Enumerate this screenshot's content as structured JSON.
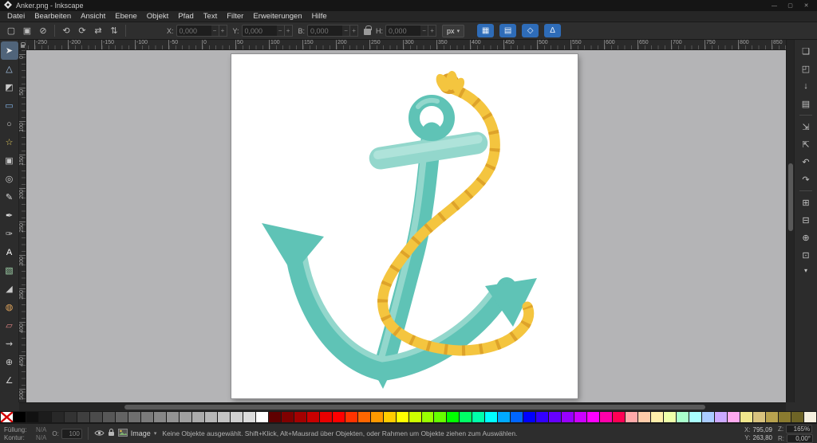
{
  "window": {
    "title": "Anker.png - Inkscape",
    "controls": [
      {
        "name": "minimize-button",
        "glyph": "—"
      },
      {
        "name": "maximize-button",
        "glyph": "▢"
      },
      {
        "name": "close-button",
        "glyph": "✕"
      }
    ]
  },
  "menu": {
    "items": [
      "Datei",
      "Bearbeiten",
      "Ansicht",
      "Ebene",
      "Objekt",
      "Pfad",
      "Text",
      "Filter",
      "Erweiterungen",
      "Hilfe"
    ]
  },
  "toolbar": {
    "select_icons": [
      {
        "name": "select-all-button",
        "glyph": "▢"
      },
      {
        "name": "select-all-layers-button",
        "glyph": "▣"
      },
      {
        "name": "deselect-button",
        "glyph": "⊘"
      }
    ],
    "transform_icons": [
      {
        "name": "rotate-ccw-button",
        "glyph": "⟲"
      },
      {
        "name": "rotate-cw-button",
        "glyph": "⟳"
      },
      {
        "name": "flip-horizontal-button",
        "glyph": "⇄"
      },
      {
        "name": "flip-vertical-button",
        "glyph": "⇅"
      }
    ],
    "fields": [
      {
        "name": "x-field",
        "label": "X:",
        "value": "0,000"
      },
      {
        "name": "y-field",
        "label": "Y:",
        "value": "0,000"
      },
      {
        "name": "width-field",
        "label": "B:",
        "value": "0,000"
      },
      {
        "name": "height-field",
        "label": "H:",
        "value": "0,000"
      }
    ],
    "spin_minus": "−",
    "spin_plus": "+",
    "unit": "px",
    "snap_buttons": [
      {
        "name": "snap-toggle-bounding-box",
        "glyph": "▦"
      },
      {
        "name": "snap-toggle-nodes",
        "glyph": "▤"
      },
      {
        "name": "snap-toggle-others",
        "glyph": "◇"
      },
      {
        "name": "snap-toggle-page",
        "glyph": "∆"
      }
    ]
  },
  "glyphs": {
    "caret_down": "▾"
  },
  "rulers": {
    "h_labels": [
      "-250",
      "-200",
      "-150",
      "-100",
      "-50",
      "0",
      "50",
      "100",
      "150",
      "200",
      "250",
      "300",
      "350",
      "400",
      "450",
      "500",
      "550",
      "600",
      "650",
      "700",
      "750",
      "800",
      "850"
    ],
    "v_labels": [
      "0",
      "50",
      "100",
      "150",
      "200",
      "250",
      "300",
      "350",
      "400",
      "450",
      "500"
    ]
  },
  "toolbox": {
    "tools": [
      {
        "name": "selector-tool",
        "glyph": "➤",
        "color": "#ececec",
        "active": true
      },
      {
        "name": "node-tool",
        "glyph": "△",
        "color": "#a8c8ec"
      },
      {
        "name": "shape-builder-tool",
        "glyph": "◩",
        "color": "#c9c9c9"
      },
      {
        "name": "rectangle-tool",
        "glyph": "▭",
        "color": "#83b3e8"
      },
      {
        "name": "ellipse-tool",
        "glyph": "○",
        "color": "#c9c9c9"
      },
      {
        "name": "star-tool",
        "glyph": "☆",
        "color": "#e8cf5e"
      },
      {
        "name": "box3d-tool",
        "glyph": "▣",
        "color": "#c9c9c9"
      },
      {
        "name": "spiral-tool",
        "glyph": "◎",
        "color": "#c9c9c9"
      },
      {
        "name": "pencil-tool",
        "glyph": "✎",
        "color": "#dcdcdc"
      },
      {
        "name": "pen-tool",
        "glyph": "✒",
        "color": "#dcdcdc"
      },
      {
        "name": "calligraphy-tool",
        "glyph": "✑",
        "color": "#c9c9c9"
      },
      {
        "name": "text-tool",
        "glyph": "A",
        "color": "#ffffff"
      },
      {
        "name": "gradient-tool",
        "glyph": "▧",
        "color": "#9fd0a8"
      },
      {
        "name": "dropper-tool",
        "glyph": "◢",
        "color": "#c9c9c9"
      },
      {
        "name": "paint-bucket-tool",
        "glyph": "◍",
        "color": "#dfa45c"
      },
      {
        "name": "eraser-tool",
        "glyph": "▱",
        "color": "#e08585"
      },
      {
        "name": "connector-tool",
        "glyph": "⇝",
        "color": "#c9c9c9"
      },
      {
        "name": "zoom-tool",
        "glyph": "⊕",
        "color": "#c9c9c9"
      },
      {
        "name": "measure-tool",
        "glyph": "∠",
        "color": "#c9c9c9"
      }
    ]
  },
  "commandbar": {
    "icons": [
      {
        "name": "document-new-button",
        "glyph": "❏"
      },
      {
        "name": "document-open-button",
        "glyph": "◰"
      },
      {
        "name": "document-save-button",
        "glyph": "↓"
      },
      {
        "name": "print-button",
        "glyph": "▤"
      },
      {
        "name": "import-button",
        "glyph": "⇲"
      },
      {
        "name": "export-button",
        "glyph": "⇱"
      },
      {
        "name": "undo-button",
        "glyph": "↶"
      },
      {
        "name": "redo-button",
        "glyph": "↷"
      },
      {
        "name": "copy-button",
        "glyph": "⊞"
      },
      {
        "name": "paste-button",
        "glyph": "⊟"
      },
      {
        "name": "zoom-page-button",
        "glyph": "⊕"
      },
      {
        "name": "document-properties-button",
        "glyph": "⊡"
      }
    ],
    "more_glyph": "▾"
  },
  "artwork": {
    "teal": "#5FC3B6",
    "teal_light": "#93D7CC",
    "teal_lighter": "#AFE3DA",
    "rope": "#F4C53F",
    "rope_dark": "#DB9E28"
  },
  "palette": {
    "colors": [
      "#000000",
      "#111111",
      "#1c1c1c",
      "#282828",
      "#333333",
      "#3f3f3f",
      "#4b4b4b",
      "#575757",
      "#636363",
      "#6f6f6f",
      "#7b7b7b",
      "#878787",
      "#939393",
      "#9f9f9f",
      "#ababab",
      "#b7b7b7",
      "#c3c3c3",
      "#d0d0d0",
      "#dddddd",
      "#ffffff",
      "#5f0000",
      "#800000",
      "#a40000",
      "#c80000",
      "#e80000",
      "#ff0000",
      "#ff3300",
      "#ff6600",
      "#ff9900",
      "#ffcc00",
      "#ffff00",
      "#ccff00",
      "#99ff00",
      "#66ff00",
      "#00ff00",
      "#00ff66",
      "#00ffaa",
      "#00ffff",
      "#00aaff",
      "#0066ff",
      "#0000ff",
      "#3300ff",
      "#6600ff",
      "#9900ff",
      "#cc00ff",
      "#ff00ff",
      "#ff00aa",
      "#ff0055",
      "#ffaaaa",
      "#ffccaa",
      "#ffeeaa",
      "#eeffaa",
      "#aaffcc",
      "#aaffff",
      "#aaccff",
      "#ccaaff",
      "#ffaaee",
      "#f0e68c",
      "#d9c37e",
      "#b8a24e",
      "#8a7a2f",
      "#6e6426",
      "#f5f0df"
    ]
  },
  "statusbar": {
    "fill_label": "Füllung:",
    "fill_value": "N/A",
    "stroke_label": "Kontur:",
    "stroke_value": "N/A",
    "opacity_label": "O:",
    "opacity_value": "100",
    "layer_name": "Image",
    "message": "Keine Objekte ausgewählt. Shift+Klick, Alt+Mausrad über Objekten, oder Rahmen um Objekte ziehen zum Auswählen.",
    "x_label": "X:",
    "x_value": "795,09",
    "y_label": "Y:",
    "y_value": "263,80",
    "zoom_label": "Z:",
    "zoom_value": "165%",
    "rotation_label": "R:",
    "rotation_value": "0,00°"
  }
}
